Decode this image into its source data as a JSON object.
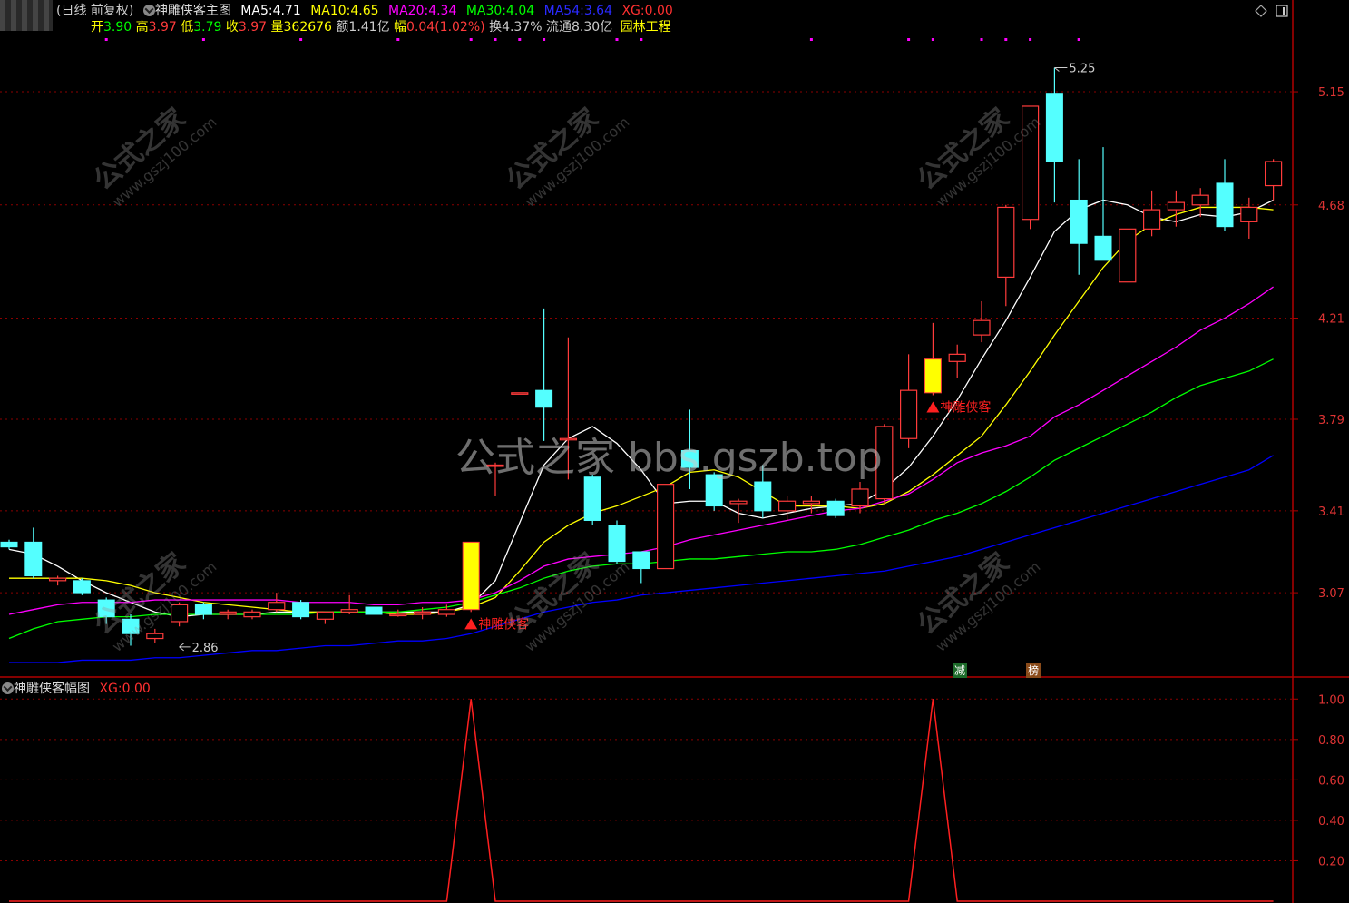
{
  "main_header": {
    "period": "(日线 前复权)",
    "indicator_name": "神雕侠客主图",
    "ma5_label": "MA5:",
    "ma5_value": "4.71",
    "ma10_label": "MA10:",
    "ma10_value": "4.65",
    "ma20_label": "MA20:",
    "ma20_value": "4.34",
    "ma30_label": "MA30:",
    "ma30_value": "4.04",
    "ma54_label": "MA54:",
    "ma54_value": "3.64",
    "xg_label": "XG:",
    "xg_value": "0.00"
  },
  "quote": {
    "open_label": "开",
    "open": "3.90",
    "high_label": "高",
    "high": "3.97",
    "low_label": "低",
    "low": "3.79",
    "close_label": "收",
    "close": "3.97",
    "volume_label": "量",
    "volume": "362676",
    "amount_label": "额",
    "amount": "1.41亿",
    "change_label": "幅",
    "change": "0.04(1.02%)",
    "turnover_label": "换",
    "turnover": "4.37%",
    "float_label": "流通",
    "float": "8.30亿",
    "sector": "园林工程"
  },
  "sub_header": {
    "indicator_name": "神雕侠客幅图",
    "xg_label": "XG:",
    "xg_value": "0.00"
  },
  "watermark": {
    "center": "公式之家 bbs.gszb.top",
    "logo": "公式之家",
    "logo_url": "www.gszj100.com"
  },
  "badges": {
    "reduce": "减",
    "list": "榜"
  },
  "colors": {
    "up": "#ff3b3b",
    "down": "#54ffff",
    "signal": "#ffff00",
    "ma5": "#ffffff",
    "ma10": "#ffff00",
    "ma20": "#ff00ff",
    "ma30": "#00ff00",
    "ma54": "#0000ff",
    "grid": "#8b0000"
  },
  "chart_data": [
    {
      "type": "candlestick",
      "title": "神雕侠客主图",
      "y_ticks": [
        "5.15",
        "4.68",
        "4.21",
        "3.79",
        "3.41",
        "3.07"
      ],
      "ylim": [
        2.72,
        5.38
      ],
      "annotations": [
        {
          "text": "5.25",
          "index": 43,
          "value": 5.25
        },
        {
          "text": "2.86",
          "index": 7,
          "value": 2.86
        },
        {
          "text": "神雕侠客",
          "index": 19,
          "marker": "up-triangle"
        },
        {
          "text": "神雕侠客",
          "index": 38,
          "marker": "up-triangle"
        }
      ],
      "candles": [
        {
          "o": 3.28,
          "h": 3.29,
          "l": 3.25,
          "c": 3.26
        },
        {
          "o": 3.28,
          "h": 3.34,
          "l": 3.13,
          "c": 3.14
        },
        {
          "o": 3.12,
          "h": 3.14,
          "l": 3.1,
          "c": 3.13
        },
        {
          "o": 3.12,
          "h": 3.13,
          "l": 3.06,
          "c": 3.07
        },
        {
          "o": 3.04,
          "h": 3.05,
          "l": 2.94,
          "c": 2.97
        },
        {
          "o": 2.96,
          "h": 2.98,
          "l": 2.85,
          "c": 2.9
        },
        {
          "o": 2.88,
          "h": 2.92,
          "l": 2.86,
          "c": 2.9
        },
        {
          "o": 2.95,
          "h": 3.03,
          "l": 2.93,
          "c": 3.02
        },
        {
          "o": 3.02,
          "h": 3.03,
          "l": 2.96,
          "c": 2.98
        },
        {
          "o": 2.98,
          "h": 3.0,
          "l": 2.96,
          "c": 2.99
        },
        {
          "o": 2.97,
          "h": 3.0,
          "l": 2.96,
          "c": 2.99
        },
        {
          "o": 3.0,
          "h": 3.07,
          "l": 2.99,
          "c": 3.03
        },
        {
          "o": 3.03,
          "h": 3.04,
          "l": 2.96,
          "c": 2.97
        },
        {
          "o": 2.96,
          "h": 2.99,
          "l": 2.94,
          "c": 2.99
        },
        {
          "o": 2.99,
          "h": 3.06,
          "l": 2.98,
          "c": 3.0
        },
        {
          "o": 3.01,
          "h": 3.01,
          "l": 2.98,
          "c": 2.98
        },
        {
          "o": 2.98,
          "h": 3.0,
          "l": 2.97,
          "c": 2.98
        },
        {
          "o": 2.98,
          "h": 3.01,
          "l": 2.96,
          "c": 2.99
        },
        {
          "o": 2.98,
          "h": 3.02,
          "l": 2.97,
          "c": 3.0
        },
        {
          "o": 3.0,
          "h": 3.28,
          "l": 2.99,
          "c": 3.28
        },
        {
          "o": 3.6,
          "h": 3.61,
          "l": 3.47,
          "c": 3.6
        },
        {
          "o": 3.9,
          "h": 3.9,
          "l": 3.9,
          "c": 3.9
        },
        {
          "o": 3.91,
          "h": 4.25,
          "l": 3.7,
          "c": 3.84
        },
        {
          "o": 3.71,
          "h": 4.13,
          "l": 3.54,
          "c": 3.71
        },
        {
          "o": 3.55,
          "h": 3.56,
          "l": 3.35,
          "c": 3.37
        },
        {
          "o": 3.35,
          "h": 3.37,
          "l": 3.19,
          "c": 3.2
        },
        {
          "o": 3.24,
          "h": 3.24,
          "l": 3.11,
          "c": 3.17
        },
        {
          "o": 3.17,
          "h": 3.52,
          "l": 3.17,
          "c": 3.52
        },
        {
          "o": 3.66,
          "h": 3.83,
          "l": 3.5,
          "c": 3.59
        },
        {
          "o": 3.56,
          "h": 3.57,
          "l": 3.41,
          "c": 3.43
        },
        {
          "o": 3.44,
          "h": 3.46,
          "l": 3.36,
          "c": 3.45
        },
        {
          "o": 3.53,
          "h": 3.6,
          "l": 3.38,
          "c": 3.41
        },
        {
          "o": 3.41,
          "h": 3.47,
          "l": 3.37,
          "c": 3.45
        },
        {
          "o": 3.44,
          "h": 3.47,
          "l": 3.4,
          "c": 3.45
        },
        {
          "o": 3.45,
          "h": 3.46,
          "l": 3.38,
          "c": 3.39
        },
        {
          "o": 3.43,
          "h": 3.53,
          "l": 3.4,
          "c": 3.5
        },
        {
          "o": 3.46,
          "h": 3.77,
          "l": 3.44,
          "c": 3.76
        },
        {
          "o": 3.71,
          "h": 4.06,
          "l": 3.67,
          "c": 3.91
        },
        {
          "o": 3.9,
          "h": 4.19,
          "l": 3.89,
          "c": 4.04
        },
        {
          "o": 4.03,
          "h": 4.1,
          "l": 3.96,
          "c": 4.06
        },
        {
          "o": 4.14,
          "h": 4.28,
          "l": 4.11,
          "c": 4.2
        },
        {
          "o": 4.38,
          "h": 4.68,
          "l": 4.26,
          "c": 4.67
        },
        {
          "o": 4.62,
          "h": 5.09,
          "l": 4.58,
          "c": 5.09
        },
        {
          "o": 5.14,
          "h": 5.25,
          "l": 4.69,
          "c": 4.86
        },
        {
          "o": 4.7,
          "h": 4.87,
          "l": 4.39,
          "c": 4.52
        },
        {
          "o": 4.55,
          "h": 4.92,
          "l": 4.45,
          "c": 4.45
        },
        {
          "o": 4.36,
          "h": 4.58,
          "l": 4.36,
          "c": 4.58
        },
        {
          "o": 4.58,
          "h": 4.74,
          "l": 4.55,
          "c": 4.66
        },
        {
          "o": 4.66,
          "h": 4.74,
          "l": 4.59,
          "c": 4.69
        },
        {
          "o": 4.68,
          "h": 4.75,
          "l": 4.63,
          "c": 4.72
        },
        {
          "o": 4.77,
          "h": 4.87,
          "l": 4.57,
          "c": 4.59
        },
        {
          "o": 4.61,
          "h": 4.71,
          "l": 4.54,
          "c": 4.67
        },
        {
          "o": 4.76,
          "h": 4.87,
          "l": 4.7,
          "c": 4.86
        }
      ],
      "signal_indices": [
        19,
        38
      ],
      "series": [
        {
          "name": "MA5",
          "values": [
            3.25,
            3.23,
            3.18,
            3.12,
            3.07,
            3.03,
            2.99,
            2.97,
            2.98,
            2.98,
            2.98,
            2.99,
            2.99,
            2.99,
            2.99,
            2.99,
            2.99,
            2.99,
            2.99,
            3.02,
            3.12,
            3.36,
            3.6,
            3.71,
            3.76,
            3.69,
            3.58,
            3.44,
            3.45,
            3.45,
            3.4,
            3.38,
            3.4,
            3.42,
            3.43,
            3.44,
            3.5,
            3.59,
            3.72,
            3.87,
            4.04,
            4.2,
            4.38,
            4.57,
            4.66,
            4.7,
            4.68,
            4.63,
            4.61,
            4.64,
            4.63,
            4.65,
            4.7
          ]
        },
        {
          "name": "MA10",
          "values": [
            3.13,
            3.13,
            3.13,
            3.13,
            3.12,
            3.1,
            3.07,
            3.05,
            3.03,
            3.02,
            3.01,
            3.0,
            2.99,
            2.99,
            2.99,
            2.99,
            2.98,
            2.98,
            2.99,
            3.01,
            3.05,
            3.16,
            3.28,
            3.35,
            3.4,
            3.43,
            3.47,
            3.51,
            3.57,
            3.58,
            3.55,
            3.49,
            3.43,
            3.43,
            3.43,
            3.42,
            3.44,
            3.49,
            3.56,
            3.64,
            3.72,
            3.85,
            3.99,
            4.14,
            4.28,
            4.42,
            4.53,
            4.6,
            4.64,
            4.67,
            4.67,
            4.67,
            4.66
          ]
        },
        {
          "name": "MA20",
          "values": [
            2.98,
            3.0,
            3.02,
            3.03,
            3.03,
            3.03,
            3.04,
            3.04,
            3.04,
            3.04,
            3.04,
            3.04,
            3.03,
            3.03,
            3.03,
            3.02,
            3.02,
            3.03,
            3.03,
            3.04,
            3.07,
            3.12,
            3.18,
            3.21,
            3.22,
            3.23,
            3.24,
            3.26,
            3.29,
            3.31,
            3.33,
            3.35,
            3.37,
            3.39,
            3.41,
            3.42,
            3.45,
            3.48,
            3.54,
            3.61,
            3.65,
            3.68,
            3.72,
            3.8,
            3.85,
            3.91,
            3.97,
            4.03,
            4.09,
            4.16,
            4.21,
            4.27,
            4.34
          ]
        },
        {
          "name": "MA30",
          "values": [
            2.88,
            2.92,
            2.95,
            2.96,
            2.97,
            2.97,
            2.98,
            2.98,
            2.98,
            2.98,
            2.98,
            2.98,
            2.98,
            2.99,
            2.99,
            2.99,
            2.99,
            3.0,
            3.01,
            3.03,
            3.06,
            3.09,
            3.13,
            3.16,
            3.18,
            3.19,
            3.19,
            3.2,
            3.21,
            3.21,
            3.22,
            3.23,
            3.24,
            3.24,
            3.25,
            3.27,
            3.3,
            3.33,
            3.37,
            3.4,
            3.44,
            3.49,
            3.55,
            3.62,
            3.67,
            3.72,
            3.77,
            3.82,
            3.88,
            3.93,
            3.96,
            3.99,
            4.04
          ]
        },
        {
          "name": "MA54",
          "values": [
            2.78,
            2.78,
            2.78,
            2.79,
            2.79,
            2.79,
            2.8,
            2.8,
            2.81,
            2.82,
            2.83,
            2.83,
            2.84,
            2.85,
            2.85,
            2.86,
            2.87,
            2.87,
            2.88,
            2.9,
            2.93,
            2.96,
            2.99,
            3.01,
            3.03,
            3.04,
            3.06,
            3.07,
            3.08,
            3.09,
            3.1,
            3.11,
            3.12,
            3.13,
            3.14,
            3.15,
            3.16,
            3.18,
            3.2,
            3.22,
            3.25,
            3.28,
            3.31,
            3.34,
            3.37,
            3.4,
            3.43,
            3.46,
            3.49,
            3.52,
            3.55,
            3.58,
            3.64
          ]
        }
      ]
    },
    {
      "type": "line",
      "title": "神雕侠客幅图",
      "y_ticks": [
        "1.00",
        "0.80",
        "0.60",
        "0.40",
        "0.20"
      ],
      "ylim": [
        0,
        1.1
      ],
      "series": [
        {
          "name": "XG",
          "values": [
            0,
            0,
            0,
            0,
            0,
            0,
            0,
            0,
            0,
            0,
            0,
            0,
            0,
            0,
            0,
            0,
            0,
            0,
            0,
            1,
            0,
            0,
            0,
            0,
            0,
            0,
            0,
            0,
            0,
            0,
            0,
            0,
            0,
            0,
            0,
            0,
            0,
            0,
            1,
            0,
            0,
            0,
            0,
            0,
            0,
            0,
            0,
            0,
            0,
            0,
            0,
            0,
            0
          ]
        }
      ]
    }
  ]
}
